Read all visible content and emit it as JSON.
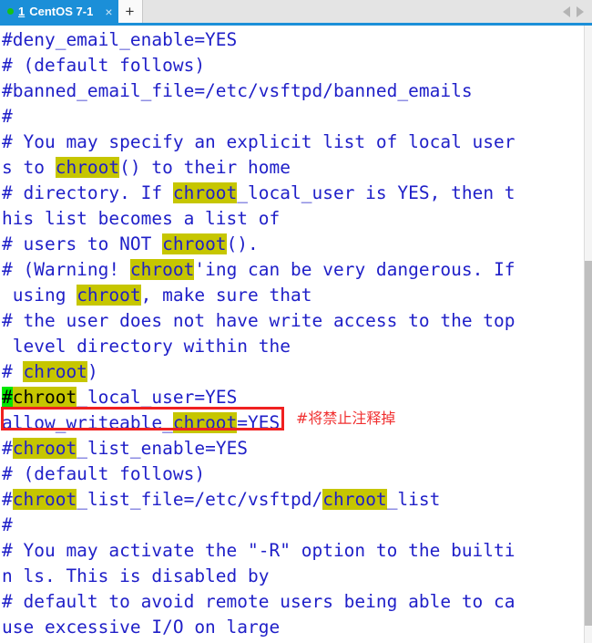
{
  "window": {
    "tab": {
      "index": "1",
      "title": "CentOS 7-1",
      "close_label": "×",
      "status_dot_color": "#16c216",
      "active_color": "#1b8fd8"
    },
    "new_tab_label": "+",
    "nav_prev_label": "prev-tab-arrow",
    "nav_next_label": "next-tab-arrow"
  },
  "editor": {
    "text_color": "#1f1fc8",
    "search_highlight_color": "#c6c600",
    "current_match_color": "#00e800",
    "annotation_color": "#f03030",
    "search_term": "chroot",
    "annotation_text": "#将禁止注释掉",
    "lines": [
      {
        "id": 0,
        "segs": [
          {
            "t": "#deny_email_enable=YES"
          }
        ]
      },
      {
        "id": 1,
        "segs": [
          {
            "t": "# (default follows)"
          }
        ]
      },
      {
        "id": 2,
        "segs": [
          {
            "t": "#banned_email_file=/etc/vsftpd/banned_emails"
          }
        ]
      },
      {
        "id": 3,
        "segs": [
          {
            "t": "#"
          }
        ]
      },
      {
        "id": 4,
        "segs": [
          {
            "t": "# You may specify an explicit list of local user"
          }
        ]
      },
      {
        "id": 5,
        "segs": [
          {
            "t": "s to "
          },
          {
            "t": "chroot",
            "h": "hl"
          },
          {
            "t": "() to their home"
          }
        ]
      },
      {
        "id": 6,
        "segs": [
          {
            "t": "# directory. If "
          },
          {
            "t": "chroot",
            "h": "hl"
          },
          {
            "t": "_local_user is YES, then t"
          }
        ]
      },
      {
        "id": 7,
        "segs": [
          {
            "t": "his list becomes a list of"
          }
        ]
      },
      {
        "id": 8,
        "segs": [
          {
            "t": "# users to NOT "
          },
          {
            "t": "chroot",
            "h": "hl"
          },
          {
            "t": "()."
          }
        ]
      },
      {
        "id": 9,
        "segs": [
          {
            "t": "# (Warning! "
          },
          {
            "t": "chroot",
            "h": "hl"
          },
          {
            "t": "'ing can be very dangerous. If"
          }
        ]
      },
      {
        "id": 10,
        "segs": [
          {
            "t": " using "
          },
          {
            "t": "chroot",
            "h": "hl"
          },
          {
            "t": ", make sure that"
          }
        ]
      },
      {
        "id": 11,
        "segs": [
          {
            "t": "# the user does not have write access to the top"
          }
        ]
      },
      {
        "id": 12,
        "segs": [
          {
            "t": " level directory within the"
          }
        ]
      },
      {
        "id": 13,
        "segs": [
          {
            "t": "# "
          },
          {
            "t": "chroot",
            "h": "hl"
          },
          {
            "t": ")"
          }
        ]
      },
      {
        "id": 14,
        "segs": [
          {
            "t": "#",
            "h": "hl-cur"
          },
          {
            "t": "chroot",
            "h": "hl-dark"
          },
          {
            "t": "_local_user=YES"
          }
        ],
        "boxed": true
      },
      {
        "id": 15,
        "segs": [
          {
            "t": "allow_writeable_"
          },
          {
            "t": "chroot",
            "h": "hl"
          },
          {
            "t": "=YES"
          }
        ]
      },
      {
        "id": 16,
        "segs": [
          {
            "t": "#"
          },
          {
            "t": "chroot",
            "h": "hl"
          },
          {
            "t": "_list_enable=YES"
          }
        ]
      },
      {
        "id": 17,
        "segs": [
          {
            "t": "# (default follows)"
          }
        ]
      },
      {
        "id": 18,
        "segs": [
          {
            "t": "#"
          },
          {
            "t": "chroot",
            "h": "hl"
          },
          {
            "t": "_list_file=/etc/vsftpd/"
          },
          {
            "t": "chroot",
            "h": "hl"
          },
          {
            "t": "_list"
          }
        ]
      },
      {
        "id": 19,
        "segs": [
          {
            "t": "#"
          }
        ]
      },
      {
        "id": 20,
        "segs": [
          {
            "t": "# You may activate the \"-R\" option to the builti"
          }
        ]
      },
      {
        "id": 21,
        "segs": [
          {
            "t": "n ls. This is disabled by"
          }
        ]
      },
      {
        "id": 22,
        "segs": [
          {
            "t": "# default to avoid remote users being able to ca"
          }
        ]
      },
      {
        "id": 23,
        "segs": [
          {
            "t": "use excessive I/O on large"
          }
        ]
      }
    ]
  }
}
